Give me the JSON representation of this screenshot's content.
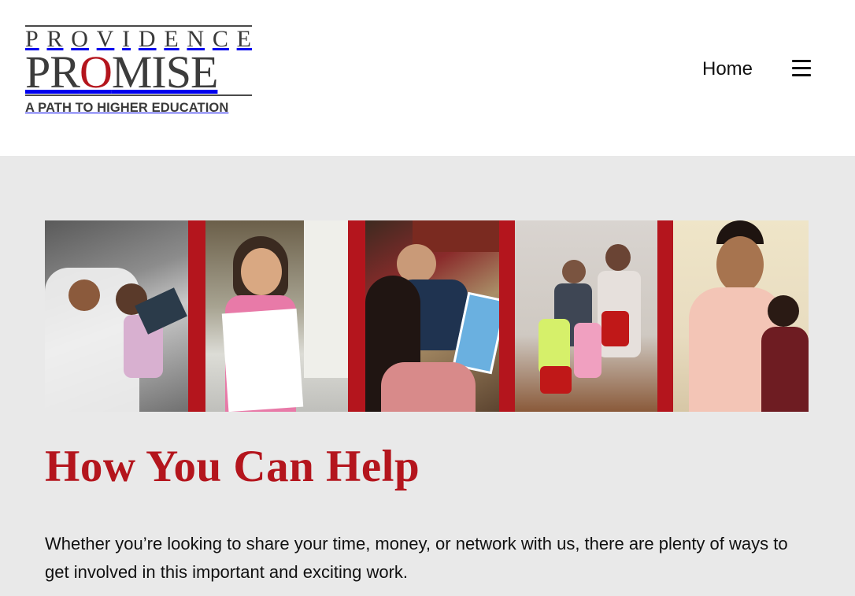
{
  "logo": {
    "top_line": [
      "P",
      "R",
      "O",
      "V",
      "I",
      "D",
      "E",
      "N",
      "C",
      "E"
    ],
    "main_before": "PR",
    "main_o": "O",
    "main_after": "MISE",
    "tagline": "A PATH TO HIGHER EDUCATION"
  },
  "nav": {
    "home_label": "Home",
    "menu_icon": "hamburger-menu-icon"
  },
  "banner": {
    "photos": [
      "father-reading-photo",
      "girl-with-paper-photo",
      "child-reading-book-photo",
      "children-with-bags-photo",
      "mother-and-son-photo"
    ],
    "accent_color": "#b4151d"
  },
  "main": {
    "title": "How You Can Help",
    "intro": "Whether you’re looking to share your time, money, or network with us, there are plenty of ways to get involved in this important and exciting work."
  },
  "colors": {
    "brand_red": "#b4151d",
    "header_bg": "#ffffff",
    "content_bg": "#e9e9e9"
  }
}
